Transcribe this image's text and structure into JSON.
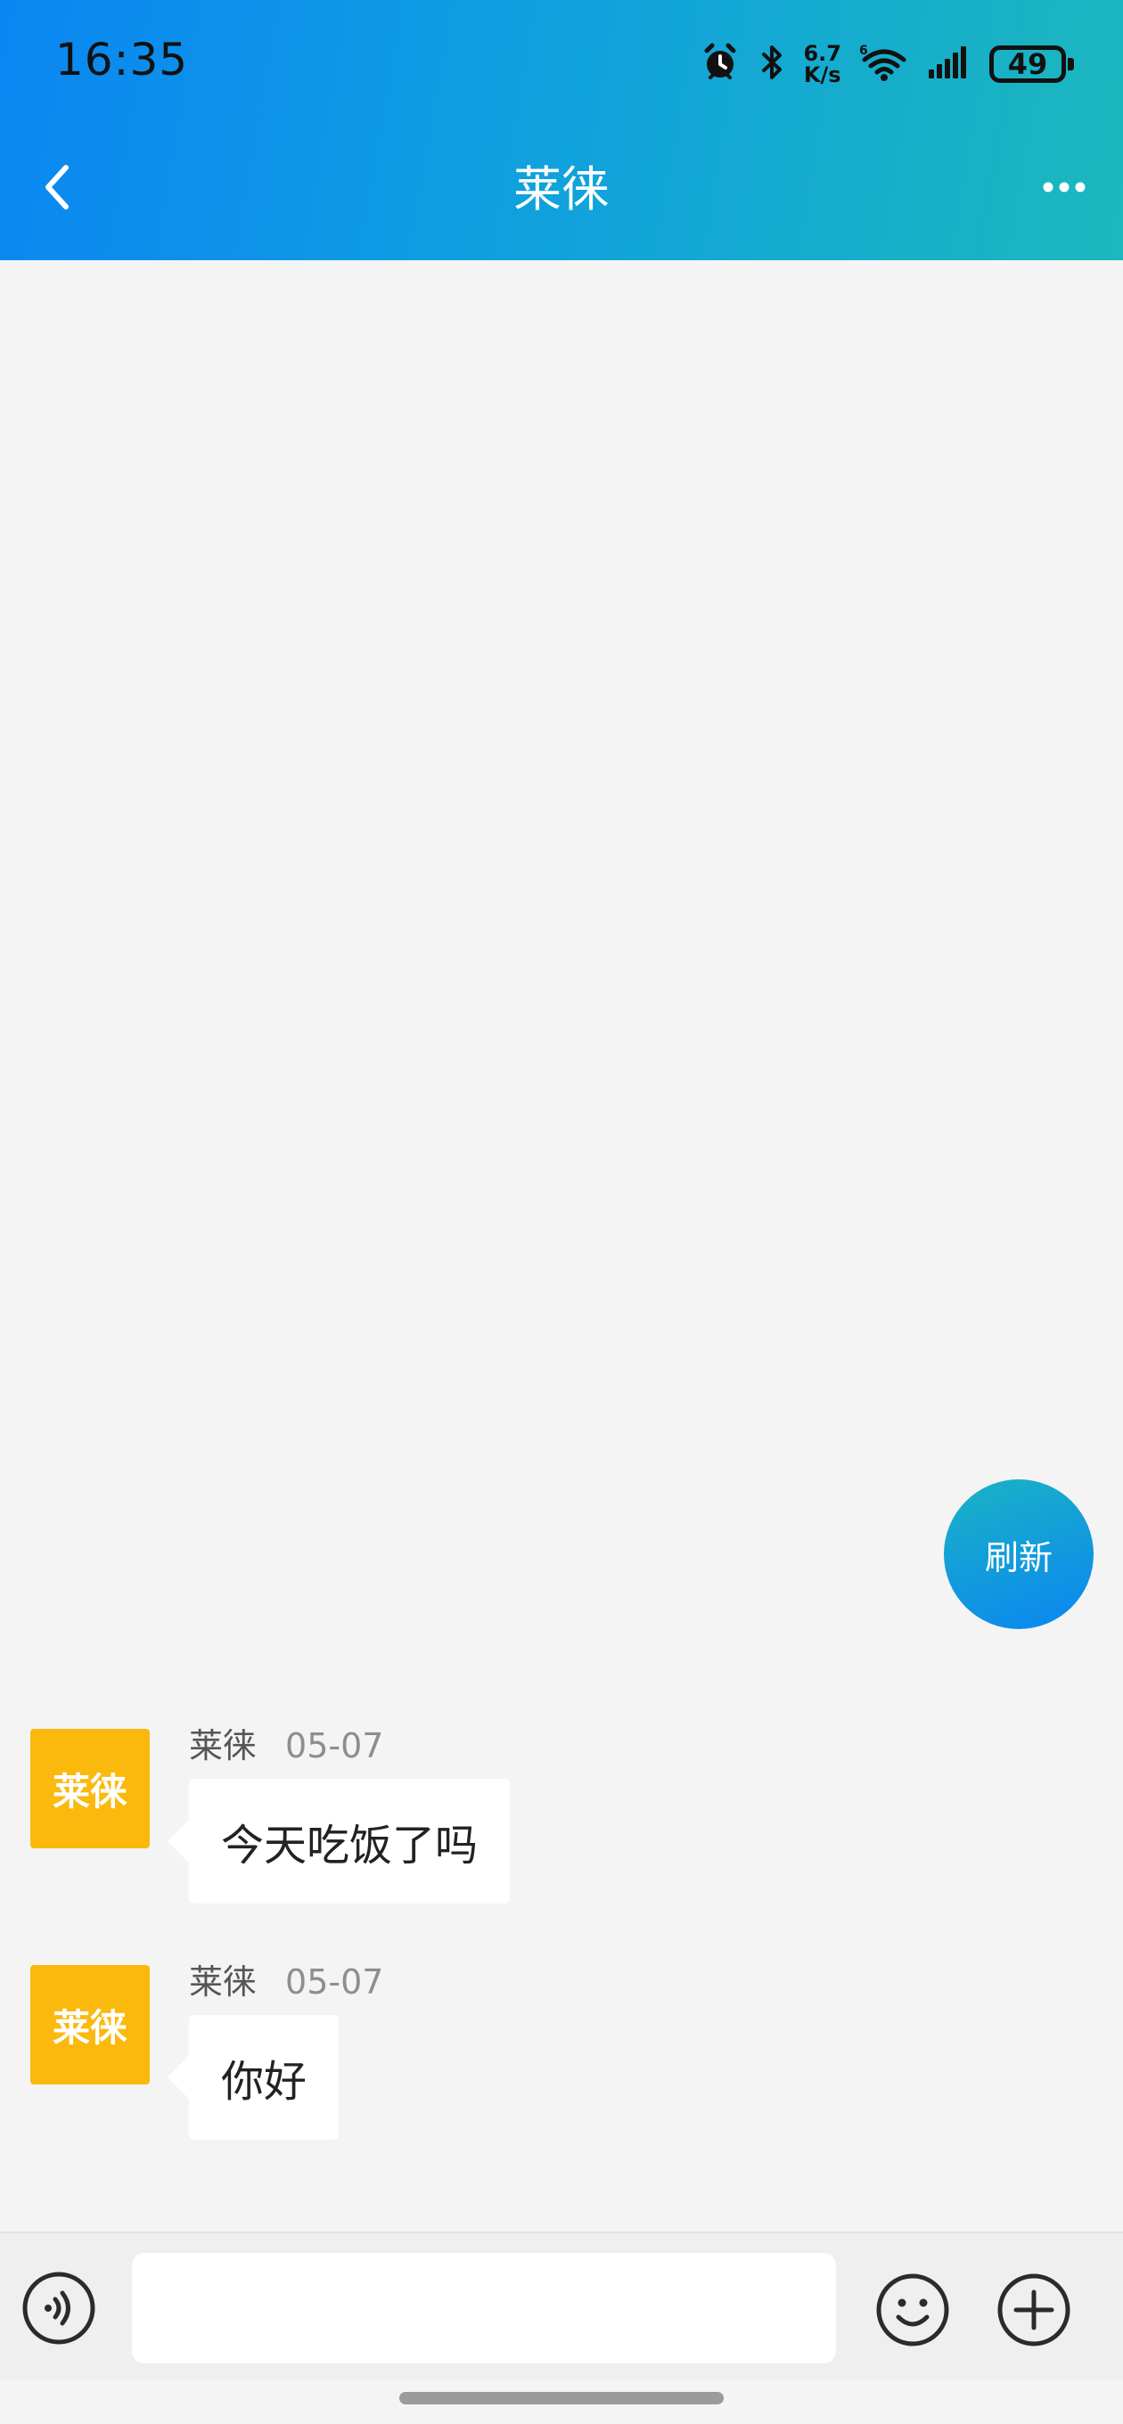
{
  "status_bar": {
    "time": "16:35",
    "net_speed_value": "6.7",
    "net_speed_unit": "K/s",
    "battery": "49"
  },
  "header": {
    "title": "莱徕"
  },
  "refresh_button": {
    "label": "刷新"
  },
  "messages": [
    {
      "avatar_text": "莱徕",
      "sender": "莱徕",
      "date": "05-07",
      "text": "今天吃饭了吗"
    },
    {
      "avatar_text": "莱徕",
      "sender": "莱徕",
      "date": "05-07",
      "text": "你好"
    }
  ],
  "input_bar": {
    "value": "",
    "placeholder": ""
  },
  "colors": {
    "header_gradient_start": "#0a86f2",
    "header_gradient_end": "#1cb8bd",
    "avatar_bg": "#fbb90e",
    "page_bg": "#f4f4f4"
  }
}
